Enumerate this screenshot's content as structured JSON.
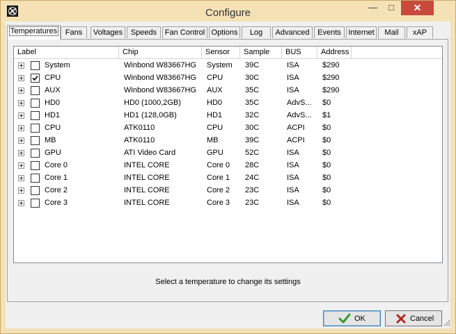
{
  "window": {
    "title": "Configure"
  },
  "titlebar": {
    "minimize_glyph": "—",
    "maximize_glyph": "□",
    "close_glyph": "✕"
  },
  "tabs": [
    {
      "label": "Temperatures",
      "active": true
    },
    {
      "label": "Fans"
    },
    {
      "label": "Voltages"
    },
    {
      "label": "Speeds"
    },
    {
      "label": "Fan Control"
    },
    {
      "label": "Options"
    },
    {
      "label": "Log"
    },
    {
      "label": "Advanced"
    },
    {
      "label": "Events"
    },
    {
      "label": "Internet"
    },
    {
      "label": "Mail"
    },
    {
      "label": "xAP"
    }
  ],
  "table": {
    "columns": [
      "Label",
      "Chip",
      "Sensor",
      "Sample",
      "BUS",
      "Address"
    ],
    "rows": [
      {
        "label": "System",
        "chip": "Winbond W83667HG",
        "sensor": "System",
        "sample": "39C",
        "bus": "ISA",
        "address": "$290",
        "checked": false
      },
      {
        "label": "CPU",
        "chip": "Winbond W83667HG",
        "sensor": "CPU",
        "sample": "30C",
        "bus": "ISA",
        "address": "$290",
        "checked": true
      },
      {
        "label": "AUX",
        "chip": "Winbond W83667HG",
        "sensor": "AUX",
        "sample": "35C",
        "bus": "ISA",
        "address": "$290",
        "checked": false
      },
      {
        "label": "HD0",
        "chip": "HD0 (1000,2GB)",
        "sensor": "HD0",
        "sample": "35C",
        "bus": "AdvS...",
        "address": "$0",
        "checked": false
      },
      {
        "label": "HD1",
        "chip": "HD1 (128,0GB)",
        "sensor": "HD1",
        "sample": "32C",
        "bus": "AdvS...",
        "address": "$1",
        "checked": false
      },
      {
        "label": "CPU",
        "chip": "ATK0110",
        "sensor": "CPU",
        "sample": "30C",
        "bus": "ACPI",
        "address": "$0",
        "checked": false
      },
      {
        "label": "MB",
        "chip": "ATK0110",
        "sensor": "MB",
        "sample": "39C",
        "bus": "ACPI",
        "address": "$0",
        "checked": false
      },
      {
        "label": "GPU",
        "chip": "ATI Video Card",
        "sensor": "GPU",
        "sample": "52C",
        "bus": "ISA",
        "address": "$0",
        "checked": false
      },
      {
        "label": "Core 0",
        "chip": "INTEL CORE",
        "sensor": "Core 0",
        "sample": "28C",
        "bus": "ISA",
        "address": "$0",
        "checked": false
      },
      {
        "label": "Core 1",
        "chip": "INTEL CORE",
        "sensor": "Core 1",
        "sample": "24C",
        "bus": "ISA",
        "address": "$0",
        "checked": false
      },
      {
        "label": "Core 2",
        "chip": "INTEL CORE",
        "sensor": "Core 2",
        "sample": "23C",
        "bus": "ISA",
        "address": "$0",
        "checked": false
      },
      {
        "label": "Core 3",
        "chip": "INTEL CORE",
        "sensor": "Core 3",
        "sample": "23C",
        "bus": "ISA",
        "address": "$0",
        "checked": false
      }
    ]
  },
  "status": {
    "text": "Select a temperature to change its settings"
  },
  "buttons": {
    "ok_label": "OK",
    "cancel_label": "Cancel"
  },
  "colors": {
    "title_bg": "#f4e2b6",
    "close_bg": "#c74a3c",
    "ok_icon": "#2f9e2f",
    "cancel_icon": "#b3261e"
  },
  "icons": {
    "app": "fan-icon",
    "ok": "checkmark-icon",
    "cancel": "x-icon"
  }
}
